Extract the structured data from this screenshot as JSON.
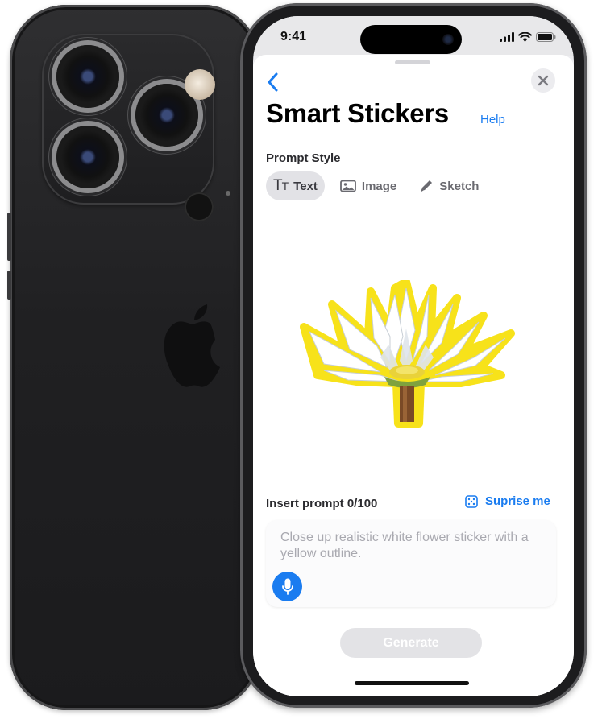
{
  "status_bar": {
    "time": "9:41"
  },
  "header": {
    "title": "Smart Stickers",
    "help_label": "Help",
    "back_icon": "chevron-left-icon",
    "close_icon": "close-icon"
  },
  "prompt_style": {
    "label": "Prompt Style",
    "options": [
      {
        "label": "Text",
        "icon": "text-format-icon",
        "selected": true
      },
      {
        "label": "Image",
        "icon": "photo-icon",
        "selected": false
      },
      {
        "label": "Sketch",
        "icon": "pencil-icon",
        "selected": false
      }
    ]
  },
  "preview": {
    "sticker_icon": "white-flower-sticker",
    "outline_color": "#f7e21a"
  },
  "prompt": {
    "label": "Insert prompt 0/100",
    "surprise_label": "Suprise me",
    "surprise_icon": "dice-icon",
    "placeholder": "Close up realistic white flower sticker with a yellow outline.",
    "value": "",
    "mic_icon": "microphone-icon"
  },
  "actions": {
    "generate_label": "Generate",
    "generate_enabled": false
  },
  "theme": {
    "accent": "#1a7cf0"
  }
}
